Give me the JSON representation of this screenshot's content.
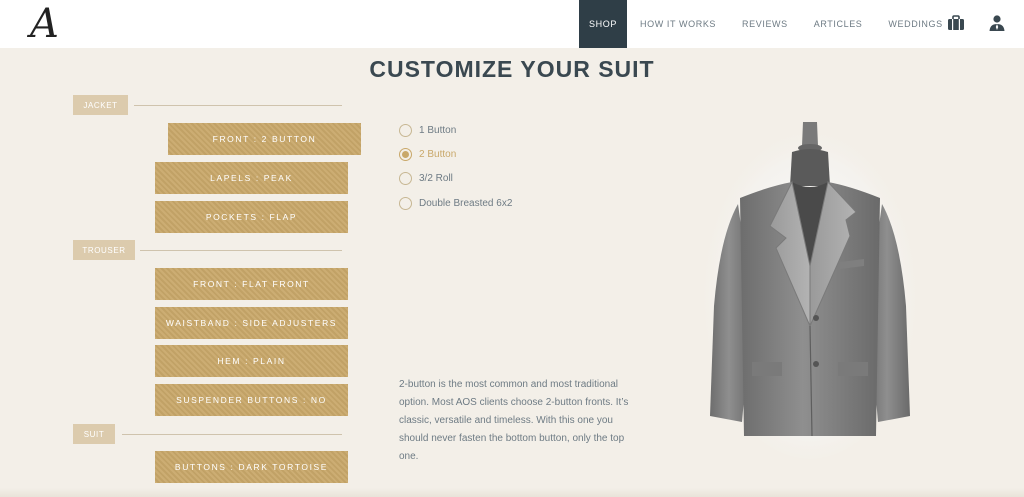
{
  "header": {
    "logo": "A",
    "nav": [
      "SHOP",
      "HOW IT WORKS",
      "REVIEWS",
      "ARTICLES",
      "WEDDINGS"
    ],
    "icons": [
      "briefcase-icon",
      "user-icon"
    ]
  },
  "page": {
    "title": "CUSTOMIZE YOUR SUIT"
  },
  "sections": {
    "jacket": "JACKET",
    "trouser": "TROUSER",
    "suit": "SUIT"
  },
  "options": {
    "jacket_front": "FRONT : 2 BUTTON",
    "lapels": "LAPELS : PEAK",
    "pockets": "POCKETS : FLAP",
    "trouser_front": "FRONT : FLAT FRONT",
    "waistband": "WAISTBAND : SIDE ADJUSTERS",
    "hem": "HEM : PLAIN",
    "suspender": "SUSPENDER BUTTONS : NO",
    "buttons": "BUTTONS : DARK TORTOISE"
  },
  "choices": {
    "items": [
      "1 Button",
      "2 Button",
      "3/2 Roll",
      "Double Breasted 6x2"
    ],
    "selected": "2 Button"
  },
  "description": "2-button is the most common and most traditional option. Most AOS clients choose 2-button fronts. It’s classic, versatile and timeless. With this one you should never fasten the bottom button, only the top one.",
  "colors": {
    "background": "#f3efe8",
    "accent_gold": "#c9a86a",
    "nav_active": "#2f3e47",
    "tag": "#dccbad"
  }
}
